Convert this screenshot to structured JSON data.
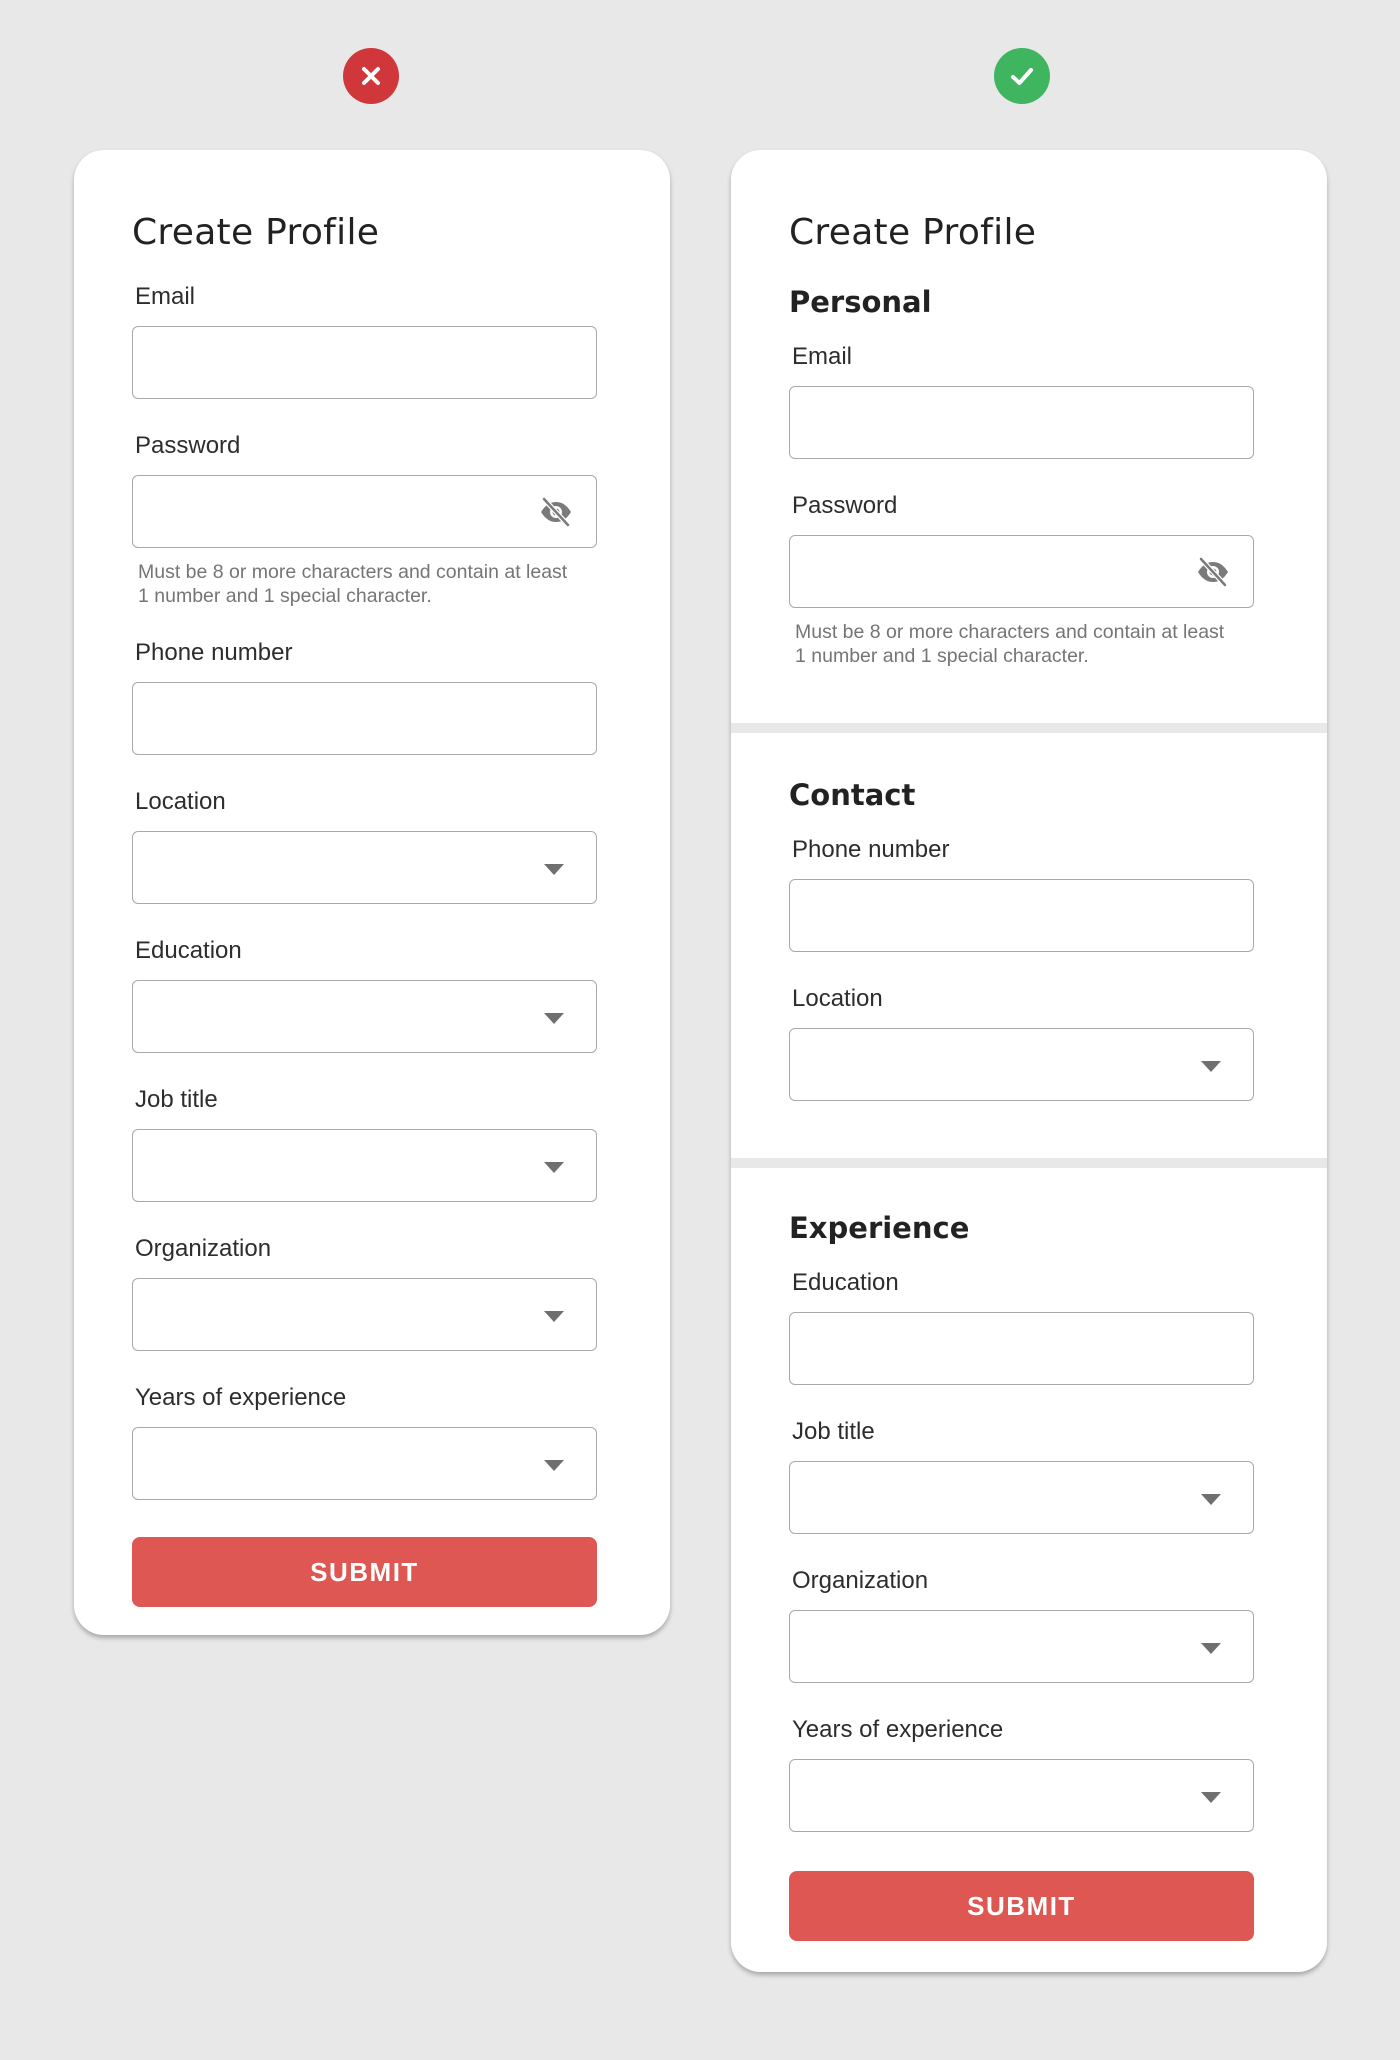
{
  "colors": {
    "background": "#e8e8e8",
    "bad_badge": "#d0373b",
    "good_badge": "#3fb560",
    "submit_button": "#de5753"
  },
  "left_card": {
    "title": "Create Profile",
    "fields": {
      "email": "Email",
      "password": "Password",
      "password_hint": "Must be 8 or more characters and contain at least 1 number and 1 special character.",
      "phone": "Phone number",
      "location": "Location",
      "education": "Education",
      "job_title": "Job title",
      "organization": "Organization",
      "years_experience": "Years of experience"
    },
    "submit_label": "SUBMIT"
  },
  "right_card": {
    "title": "Create Profile",
    "personal": {
      "heading": "Personal",
      "email": "Email",
      "password": "Password",
      "password_hint": "Must be 8 or more characters and contain at least 1 number and 1 special character."
    },
    "contact": {
      "heading": "Contact",
      "phone": "Phone number",
      "location": "Location"
    },
    "experience": {
      "heading": "Experience",
      "education": "Education",
      "job_title": "Job title",
      "organization": "Organization",
      "years_experience": "Years of experience"
    },
    "submit_label": "SUBMIT"
  },
  "icons": {
    "bad": "x-mark-icon",
    "good": "check-mark-icon",
    "password_toggle": "eye-off-icon",
    "dropdown": "chevron-down-icon"
  }
}
